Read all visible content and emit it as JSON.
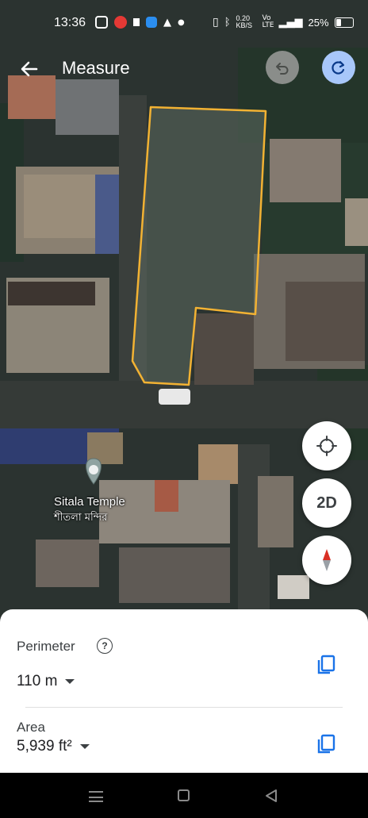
{
  "status_bar": {
    "time": "13:36",
    "network": "0.20 KB/S",
    "battery": "25%"
  },
  "header": {
    "title": "Measure"
  },
  "map": {
    "place": {
      "name_en": "Sitala Temple",
      "name_bn": "শীতলা মন্দির"
    }
  },
  "controls": {
    "view_mode": "2D"
  },
  "sheet": {
    "perimeter": {
      "label": "Perimeter",
      "value": "110 m"
    },
    "area": {
      "label": "Area",
      "value": "5,939 ft²"
    }
  },
  "colors": {
    "measure_outline": "#f2b233",
    "accent": "#1a73e8",
    "redo_fab": "#a8c7fa"
  }
}
